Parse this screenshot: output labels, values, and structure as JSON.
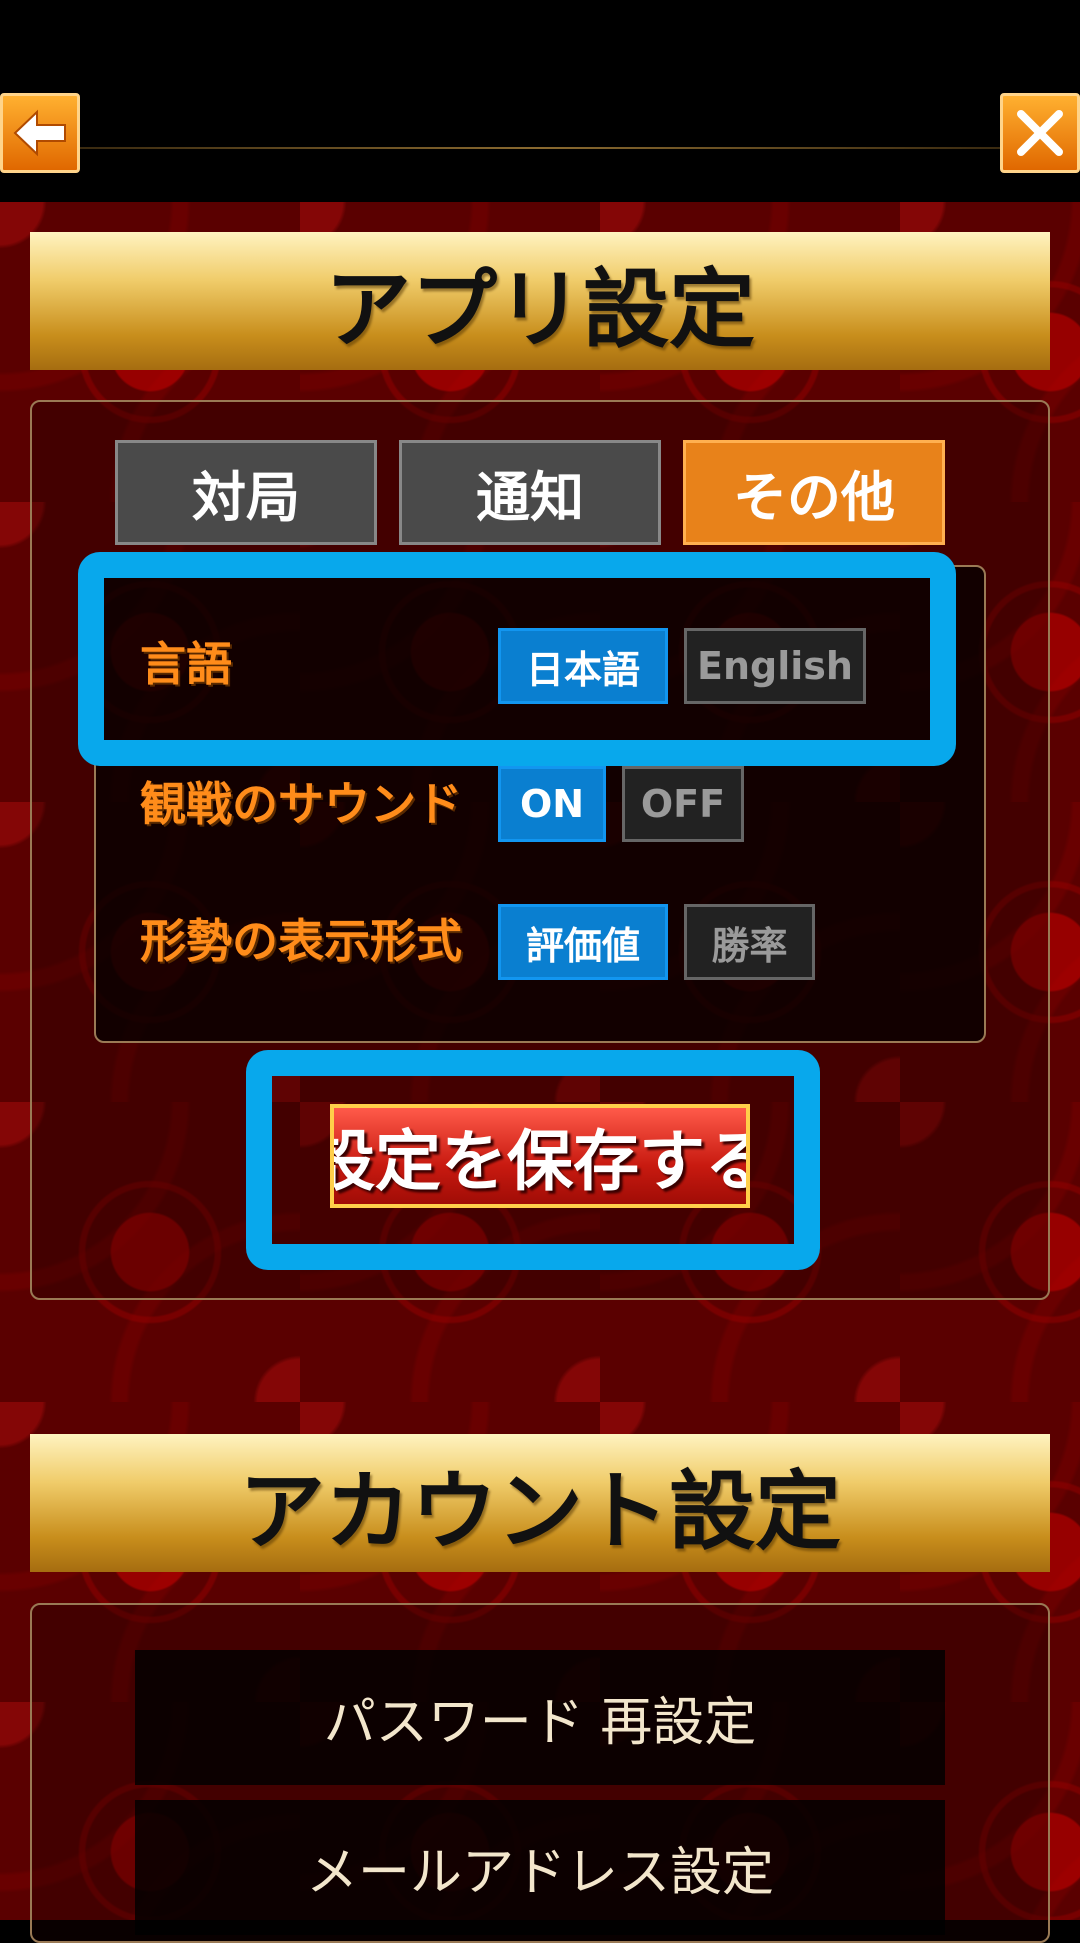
{
  "app_settings": {
    "title": "アプリ設定",
    "tabs": [
      {
        "label": "対局",
        "active": false
      },
      {
        "label": "通知",
        "active": false
      },
      {
        "label": "その他",
        "active": true
      }
    ],
    "rows": [
      {
        "label": "言語",
        "options": [
          {
            "label": "日本語",
            "selected": true
          },
          {
            "label": "English",
            "selected": false
          }
        ]
      },
      {
        "label": "観戦のサウンド",
        "options": [
          {
            "label": "ON",
            "selected": true
          },
          {
            "label": "OFF",
            "selected": false
          }
        ]
      },
      {
        "label": "形勢の表示形式",
        "options": [
          {
            "label": "評価値",
            "selected": true
          },
          {
            "label": "勝率",
            "selected": false
          }
        ]
      }
    ],
    "save_label": "設定を保存する"
  },
  "account_settings": {
    "title": "アカウント設定",
    "buttons": [
      {
        "label": "パスワード 再設定"
      },
      {
        "label": "メールアドレス設定"
      }
    ]
  },
  "icons": {
    "back": "arrow-left-icon",
    "close": "close-icon"
  },
  "colors": {
    "highlight": "#08a8ec",
    "active_tab": "#e8821a",
    "selected_option": "#0a7fd0",
    "label": "#ff8c1a"
  }
}
